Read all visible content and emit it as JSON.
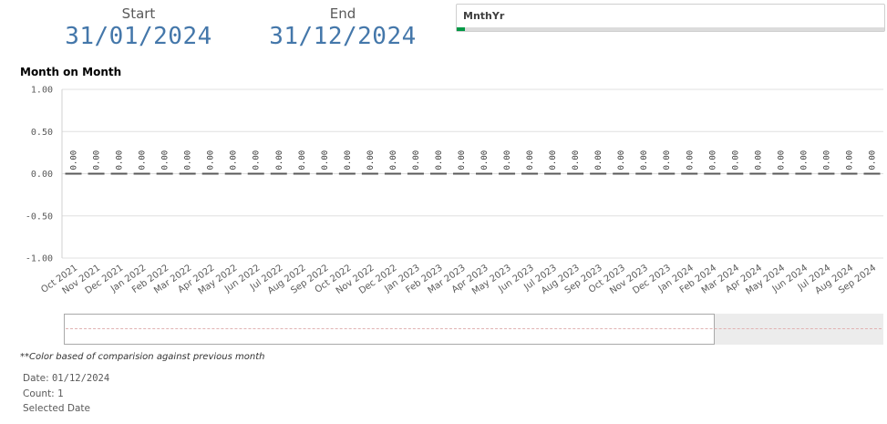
{
  "kpis": {
    "start": {
      "label": "Start",
      "value": "31/01/2024"
    },
    "end": {
      "label": "End",
      "value": "31/12/2024"
    }
  },
  "filter": {
    "label": "MnthYr",
    "selected_fraction": 0.02,
    "selected_color": "#009845"
  },
  "chart": {
    "title": "Month on Month"
  },
  "chart_data": {
    "type": "bar",
    "title": "Month on Month",
    "xlabel": "",
    "ylabel": "",
    "ylim": [
      -1.0,
      1.0
    ],
    "yticks": [
      "1.00",
      "0.50",
      "0.00",
      "-0.50",
      "-1.00"
    ],
    "ytick_values": [
      1.0,
      0.5,
      0.0,
      -0.5,
      -1.0
    ],
    "grid": true,
    "categories": [
      "Oct 2021",
      "Nov 2021",
      "Dec 2021",
      "Jan 2022",
      "Feb 2022",
      "Mar 2022",
      "Apr 2022",
      "May 2022",
      "Jun 2022",
      "Jul 2022",
      "Aug 2022",
      "Sep 2022",
      "Oct 2022",
      "Nov 2022",
      "Dec 2022",
      "Jan 2023",
      "Feb 2023",
      "Mar 2023",
      "Apr 2023",
      "May 2023",
      "Jun 2023",
      "Jul 2023",
      "Aug 2023",
      "Sep 2023",
      "Oct 2023",
      "Nov 2023",
      "Dec 2023",
      "Jan 2024",
      "Feb 2024",
      "Mar 2024",
      "Apr 2024",
      "May 2024",
      "Jun 2024",
      "Jul 2024",
      "Aug 2024",
      "Sep 2024"
    ],
    "values": [
      0,
      0,
      0,
      0,
      0,
      0,
      0,
      0,
      0,
      0,
      0,
      0,
      0,
      0,
      0,
      0,
      0,
      0,
      0,
      0,
      0,
      0,
      0,
      0,
      0,
      0,
      0,
      0,
      0,
      0,
      0,
      0,
      0,
      0,
      0,
      0
    ],
    "data_labels": [
      "0.00",
      "0.00",
      "0.00",
      "0.00",
      "0.00",
      "0.00",
      "0.00",
      "0.00",
      "0.00",
      "0.00",
      "0.00",
      "0.00",
      "0.00",
      "0.00",
      "0.00",
      "0.00",
      "0.00",
      "0.00",
      "0.00",
      "0.00",
      "0.00",
      "0.00",
      "0.00",
      "0.00",
      "0.00",
      "0.00",
      "0.00",
      "0.00",
      "0.00",
      "0.00",
      "0.00",
      "0.00",
      "0.00",
      "0.00",
      "0.00",
      "0.00"
    ],
    "bar_color": "#595959",
    "grid_color": "#e0e0e0"
  },
  "footer": {
    "note": "**Color based of comparision against previous month",
    "date_label": "Date:",
    "date_value": "01/12/2024",
    "count_label": "Count:",
    "count_value": "1",
    "selected_label": "Selected Date"
  }
}
